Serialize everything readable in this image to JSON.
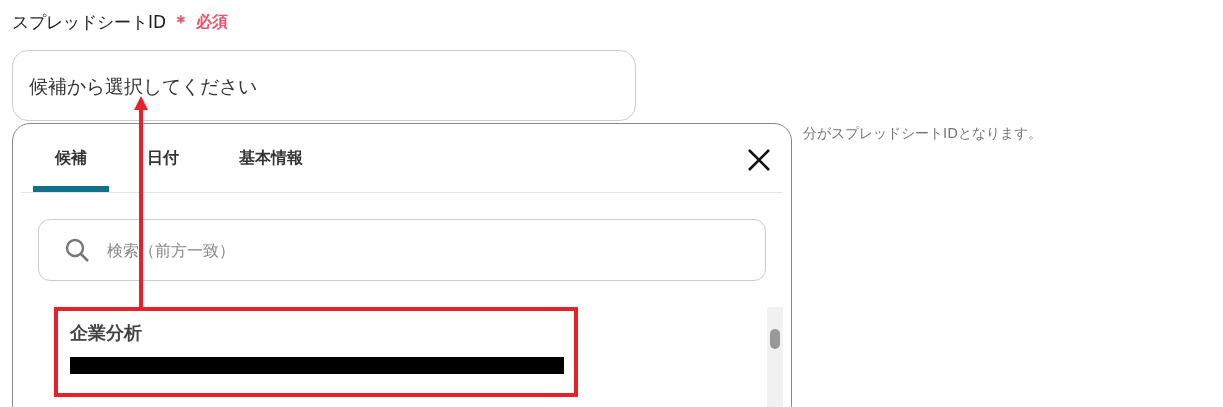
{
  "field": {
    "label": "スプレッドシートID",
    "required_mark": "＊",
    "required_label": "必須",
    "placeholder": "候補から選択してください",
    "hint": "分がスプレッドシートIDとなります。"
  },
  "popover": {
    "tabs": [
      {
        "label": "候補",
        "selected": true
      },
      {
        "label": "日付",
        "selected": false
      },
      {
        "label": "基本情報",
        "selected": false
      }
    ],
    "search": {
      "placeholder": "検索（前方一致）"
    },
    "items": [
      {
        "title": "企業分析",
        "redacted": true
      }
    ]
  },
  "annotation": {
    "highlight": true
  }
}
